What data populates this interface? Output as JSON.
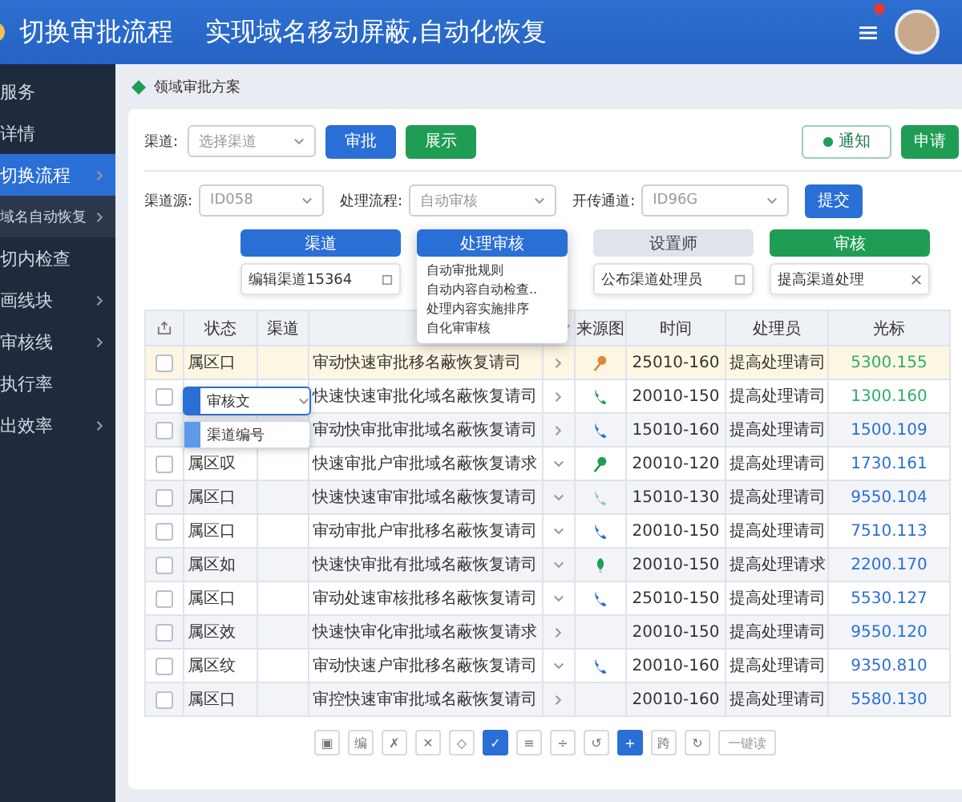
{
  "header": {
    "title": "切换审批流程",
    "subtitle": "实现域名移动屏蔽,自动化恢复"
  },
  "sidebar": {
    "items": [
      {
        "label": "服务",
        "kind": "item",
        "selected": false,
        "expandable": false
      },
      {
        "label": "详情",
        "kind": "item",
        "selected": false,
        "expandable": false
      },
      {
        "label": "切换流程",
        "kind": "item",
        "selected": true,
        "expandable": true
      },
      {
        "label": "域名自动恢复",
        "kind": "subitem",
        "selected": false,
        "expandable": true
      },
      {
        "label": "切内检查",
        "kind": "item",
        "selected": false,
        "expandable": false
      },
      {
        "label": "画线块",
        "kind": "item",
        "selected": false,
        "expandable": true
      },
      {
        "label": "审核线",
        "kind": "item",
        "selected": false,
        "expandable": true
      },
      {
        "label": "执行率",
        "kind": "item",
        "selected": false,
        "expandable": false
      },
      {
        "label": "出效率",
        "kind": "item",
        "selected": false,
        "expandable": true
      }
    ]
  },
  "breadcrumb": "领域审批方案",
  "filter_row_1": {
    "label": "渠道:",
    "select": {
      "placeholder": "选择渠道"
    },
    "buttons": [
      {
        "label": "审批",
        "kind": "primary"
      },
      {
        "label": "展示",
        "kind": "success"
      }
    ],
    "right_buttons": [
      {
        "label": "通知",
        "kind": "outline"
      },
      {
        "label": "申请",
        "kind": "success"
      }
    ]
  },
  "filter_row_2": {
    "selects": [
      {
        "label": "渠道源:",
        "value": "ID058"
      },
      {
        "label": "处理流程:",
        "value": "自动审核"
      },
      {
        "label": "开传通道:",
        "value": "ID96G"
      }
    ],
    "button": "提交"
  },
  "panels": [
    {
      "title": "渠道",
      "kind": "primary",
      "field": "编辑渠道15364",
      "closable": false
    },
    {
      "title": "处理审核",
      "kind": "primary",
      "list": [
        "自动审批规则",
        "自动内容自动检查..",
        "处理内容实施排序",
        "自化审审核"
      ]
    },
    {
      "title": "设置师",
      "kind": "neutral",
      "field": "公布渠道处理员",
      "closable": false
    },
    {
      "title": "审核",
      "kind": "success",
      "field": "提高渠道处理",
      "closable": true
    }
  ],
  "table": {
    "columns": [
      "状态",
      "渠道",
      "来源图",
      "时间",
      "处理员",
      "光标"
    ],
    "rows": [
      {
        "status": "属区口",
        "desc": "审动快速审批移名蔽恢复请司",
        "expanded": false,
        "icon": {
          "kind": "pin",
          "color": "#e0883a"
        },
        "time": "25010-160",
        "handler": "提高处理请司",
        "value": "5300.155",
        "color": "#2fae6a",
        "selected": true
      },
      {
        "desc": "快速快速审批化域名蔽恢复请司",
        "expanded": false,
        "icon": {
          "kind": "phone",
          "color": "#1f9d55"
        },
        "time": "20010-150",
        "handler": "提高处理请司",
        "value": "1300.160",
        "color": "#2fae6a",
        "selected": false
      },
      {
        "desc": "审动快审批审批域名蔽恢复请司",
        "expanded": false,
        "icon": {
          "kind": "phone",
          "color": "#2a6fd6"
        },
        "time": "15010-160",
        "handler": "提高处理请司",
        "value": "1500.109",
        "color": "#2a6fd6",
        "selected": false
      },
      {
        "status": "属区叹",
        "desc": "快速审批户审批域名蔽恢复请求",
        "expanded": true,
        "icon": {
          "kind": "pin",
          "color": "#1f9d55"
        },
        "time": "20010-120",
        "handler": "提高处理请司",
        "value": "1730.161",
        "color": "#2a6fd6",
        "selected": false
      },
      {
        "status": "属区口",
        "desc": "快速快速审审批域名蔽恢复请司",
        "expanded": true,
        "icon": {
          "kind": "phone",
          "color": "#8fcf9f"
        },
        "time": "15010-130",
        "handler": "提高处理请司",
        "value": "9550.104",
        "color": "#2a6fd6",
        "selected": false
      },
      {
        "status": "属区口",
        "desc": "审动审批户审批移名蔽恢复请司",
        "expanded": true,
        "icon": {
          "kind": "phone",
          "color": "#2a6fd6"
        },
        "time": "20010-150",
        "handler": "提高处理请司",
        "value": "7510.113",
        "color": "#2a6fd6",
        "selected": false
      },
      {
        "status": "属区如",
        "desc": "快速快审批有批域名蔽恢复请司",
        "expanded": true,
        "icon": {
          "kind": "leaf",
          "color": "#1f9d55"
        },
        "time": "20010-150",
        "handler": "提高处理请求",
        "value": "2200.170",
        "color": "#2a6fd6",
        "selected": false
      },
      {
        "status": "属区口",
        "desc": "审动处速审核批移名蔽恢复请司",
        "expanded": true,
        "icon": {
          "kind": "phone",
          "color": "#2a6fd6"
        },
        "time": "25010-150",
        "handler": "提高处理请司",
        "value": "5530.127",
        "color": "#2a6fd6",
        "selected": false
      },
      {
        "status": "属区效",
        "desc": "快速快审化审批域名蔽恢复请求",
        "expanded": false,
        "time": "20010-150",
        "handler": "提高处理请司",
        "value": "9550.120",
        "color": "#2a6fd6",
        "selected": false
      },
      {
        "status": "属区纹",
        "desc": "审动快速户审批移名蔽恢复请司",
        "expanded": true,
        "icon": {
          "kind": "phone",
          "color": "#2a6fd6"
        },
        "time": "20010-160",
        "handler": "提高处理请司",
        "value": "9350.810",
        "color": "#2a6fd6",
        "selected": false
      },
      {
        "status": "属区口",
        "desc": "审控快速审审批域名蔽恢复请司",
        "expanded": false,
        "time": "20010-160",
        "handler": "提高处理请司",
        "value": "5580.130",
        "color": "#2a6fd6",
        "selected": false
      }
    ]
  },
  "row_overlays": [
    {
      "label": "审核文",
      "kind": "select"
    },
    {
      "label": "渠道编号",
      "kind": "input"
    }
  ],
  "pager": [
    {
      "label": "▣",
      "selected": false
    },
    {
      "label": "编",
      "selected": false
    },
    {
      "label": "✗",
      "selected": false
    },
    {
      "label": "✕",
      "selected": false
    },
    {
      "label": "◇",
      "selected": false
    },
    {
      "label": "✓",
      "selected": true
    },
    {
      "label": "≡",
      "selected": false
    },
    {
      "label": "÷",
      "selected": false
    },
    {
      "label": "↺",
      "selected": false
    },
    {
      "label": "+",
      "selected": true
    },
    {
      "label": "跨",
      "selected": false
    },
    {
      "label": "↻",
      "selected": false
    }
  ],
  "pager_action": "一键读"
}
